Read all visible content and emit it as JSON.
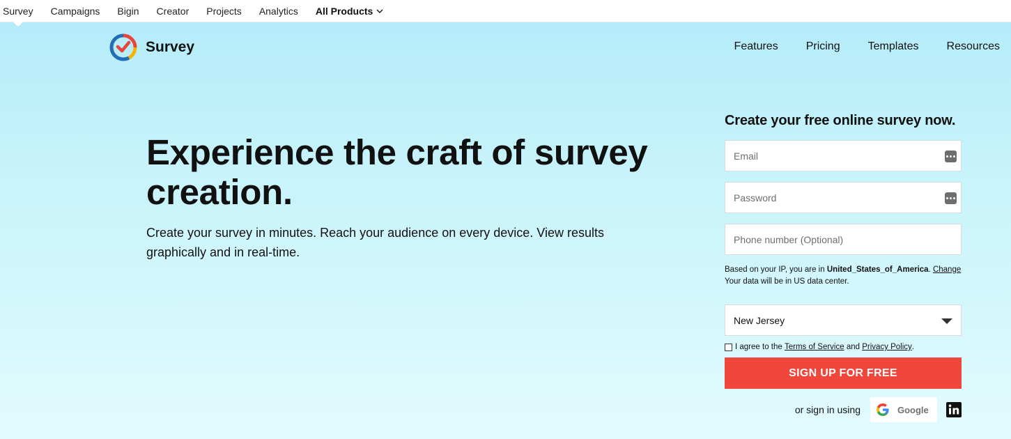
{
  "product_bar": {
    "items": [
      "Survey",
      "Campaigns",
      "Bigin",
      "Creator",
      "Projects",
      "Analytics"
    ],
    "all_products_label": "All Products"
  },
  "header": {
    "brand_name": "Survey",
    "nav": [
      "Features",
      "Pricing",
      "Templates",
      "Resources"
    ]
  },
  "hero": {
    "headline": "Experience the craft of survey creation.",
    "subcopy": "Create your survey in minutes. Reach your audience on every device. View results graphically and in real-time."
  },
  "form": {
    "title": "Create your free online survey now.",
    "email_placeholder": "Email",
    "password_placeholder": "Password",
    "phone_placeholder": "Phone number (Optional)",
    "ip_prefix": "Based on your IP, you are in ",
    "ip_country": "United_States_of_America",
    "ip_period": ". ",
    "change_link": "Change",
    "datacenter_note": "Your data will be in US data center.",
    "region_selected": "New Jersey",
    "agree_prefix": "I agree to the ",
    "terms_link": "Terms of Service",
    "agree_and": " and ",
    "privacy_link": "Privacy Policy",
    "agree_suffix": ".",
    "signup_label": "SIGN UP FOR FREE",
    "or_sign_in": "or sign in using",
    "google_label": "Google"
  },
  "colors": {
    "accent": "#f0463c",
    "hero_top": "#b5ecfa",
    "hero_bottom": "#e2fbfd"
  }
}
